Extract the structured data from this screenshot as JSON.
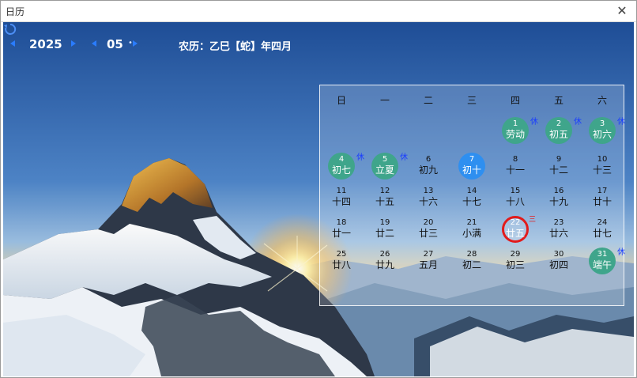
{
  "window": {
    "title": "日历",
    "close_glyph": "✕"
  },
  "toolbar": {
    "year": "2025",
    "month": "05",
    "month_dot": "•",
    "lunar_info": "农历：乙巳【蛇】年四月"
  },
  "calendar": {
    "weekdays": [
      "日",
      "一",
      "二",
      "三",
      "四",
      "五",
      "六"
    ],
    "days": [
      {
        "n": "1",
        "lunar": "劳动",
        "holiday": true,
        "badge": "休"
      },
      {
        "n": "2",
        "lunar": "初五",
        "holiday": true,
        "badge": "休"
      },
      {
        "n": "3",
        "lunar": "初六",
        "holiday": true,
        "badge": "休"
      },
      {
        "n": "4",
        "lunar": "初七",
        "holiday": true,
        "badge": "休"
      },
      {
        "n": "5",
        "lunar": "立夏",
        "holiday": true,
        "badge": "休"
      },
      {
        "n": "6",
        "lunar": "初九"
      },
      {
        "n": "7",
        "lunar": "初十",
        "today": true
      },
      {
        "n": "8",
        "lunar": "十一"
      },
      {
        "n": "9",
        "lunar": "十二"
      },
      {
        "n": "10",
        "lunar": "十三"
      },
      {
        "n": "11",
        "lunar": "十四"
      },
      {
        "n": "12",
        "lunar": "十五"
      },
      {
        "n": "13",
        "lunar": "十六"
      },
      {
        "n": "14",
        "lunar": "十七"
      },
      {
        "n": "15",
        "lunar": "十八"
      },
      {
        "n": "16",
        "lunar": "十九"
      },
      {
        "n": "17",
        "lunar": "廿十"
      },
      {
        "n": "18",
        "lunar": "廿一"
      },
      {
        "n": "19",
        "lunar": "廿二"
      },
      {
        "n": "20",
        "lunar": "廿三"
      },
      {
        "n": "21",
        "lunar": "小满"
      },
      {
        "n": "22",
        "lunar": "廿五",
        "selected": true,
        "badge": "三"
      },
      {
        "n": "23",
        "lunar": "廿六"
      },
      {
        "n": "24",
        "lunar": "廿七"
      },
      {
        "n": "25",
        "lunar": "廿八"
      },
      {
        "n": "26",
        "lunar": "廿九"
      },
      {
        "n": "27",
        "lunar": "五月"
      },
      {
        "n": "28",
        "lunar": "初二"
      },
      {
        "n": "29",
        "lunar": "初三"
      },
      {
        "n": "30",
        "lunar": "初四"
      },
      {
        "n": "31",
        "lunar": "端午",
        "holiday": true,
        "badge": "休"
      }
    ],
    "first_weekday": 4
  },
  "colors": {
    "holiday": "#3fa58b",
    "today": "#2e8ff0",
    "selected_ring": "#e21b1b",
    "nav_arrow": "#2a7cff",
    "badge": "#1a3cff"
  }
}
